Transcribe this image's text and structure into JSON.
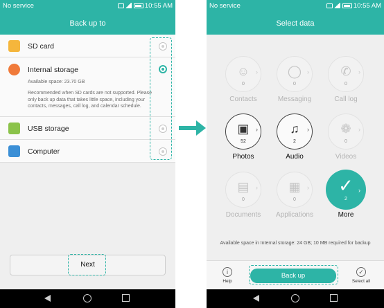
{
  "left_phone": {
    "status": {
      "carrier": "No service",
      "time": "10:55 AM"
    },
    "title": "Back up to",
    "items": [
      {
        "label": "SD card",
        "icon": "sd-card-icon",
        "selected": false
      },
      {
        "label": "Internal storage",
        "icon": "internal-storage-icon",
        "selected": true,
        "available": "Available space: 23.70 GB",
        "note": "Recommended when SD cards are not supported. Please only back up data that takes little space, including your contacts, messages, call log, and calendar schedule."
      },
      {
        "label": "USB storage",
        "icon": "usb-icon",
        "selected": false
      },
      {
        "label": "Computer",
        "icon": "computer-icon",
        "selected": false
      }
    ],
    "next_label": "Next"
  },
  "right_phone": {
    "status": {
      "carrier": "No service",
      "time": "10:55 AM"
    },
    "title": "Select data",
    "grid": [
      {
        "label": "Contacts",
        "count": "0",
        "icon": "contacts-icon",
        "state": "disabled"
      },
      {
        "label": "Messaging",
        "count": "0",
        "icon": "messaging-icon",
        "state": "disabled"
      },
      {
        "label": "Call log",
        "count": "0",
        "icon": "call-log-icon",
        "state": "disabled"
      },
      {
        "label": "Photos",
        "count": "52",
        "icon": "photos-icon",
        "state": "enabled"
      },
      {
        "label": "Audio",
        "count": "2",
        "icon": "audio-icon",
        "state": "enabled"
      },
      {
        "label": "Videos",
        "count": "0",
        "icon": "videos-icon",
        "state": "disabled"
      },
      {
        "label": "Documents",
        "count": "0",
        "icon": "documents-icon",
        "state": "disabled"
      },
      {
        "label": "Applications",
        "count": "0",
        "icon": "applications-icon",
        "state": "disabled"
      },
      {
        "label": "More",
        "count": "2",
        "icon": "check-icon",
        "state": "selected"
      }
    ],
    "available_text": "Available space in Internal storage: 24 GB; 10 MB required for backup",
    "help_label": "Help",
    "backup_label": "Back up",
    "select_all_label": "Select all"
  },
  "colors": {
    "accent": "#2db4a6"
  }
}
